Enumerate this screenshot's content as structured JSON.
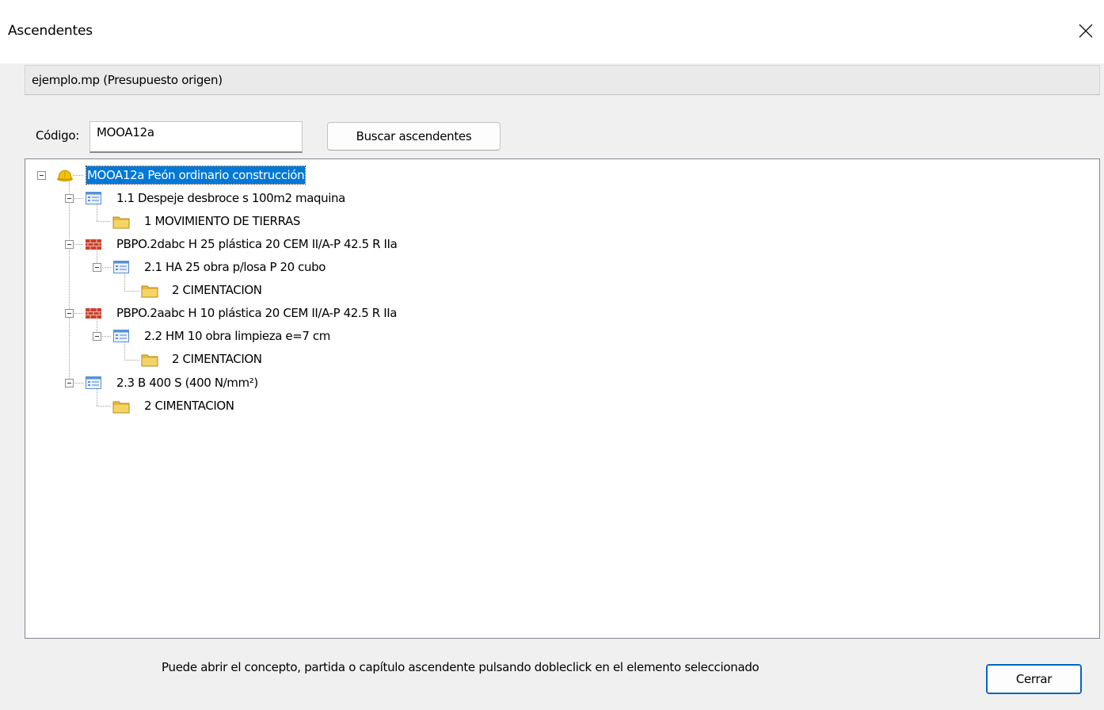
{
  "window": {
    "title": "Ascendentes"
  },
  "source": {
    "label": "ejemplo.mp (Presupuesto origen)"
  },
  "search": {
    "code_label": "Código:",
    "code_value": "MOOA12a",
    "search_button": "Buscar ascendentes"
  },
  "tree": {
    "nodes": [
      {
        "label": "MOOA12a Peón ordinario construcción",
        "icon": "hard-hat-icon",
        "selected": true
      },
      {
        "label": "1.1 Despeje desbroce s 100m2 maquina",
        "icon": "item-list-icon"
      },
      {
        "label": "1 MOVIMIENTO DE TIERRAS",
        "icon": "folder-icon"
      },
      {
        "label": "PBPO.2dabc H 25 plástica 20 CEM II/A-P 42.5 R IIa",
        "icon": "brick-icon"
      },
      {
        "label": "2.1 HA 25 obra p/losa P 20 cubo",
        "icon": "item-list-icon"
      },
      {
        "label": "2 CIMENTACION",
        "icon": "folder-icon"
      },
      {
        "label": "PBPO.2aabc H 10 plástica 20 CEM II/A-P 42.5 R IIa",
        "icon": "brick-icon"
      },
      {
        "label": "2.2 HM 10 obra limpieza e=7 cm",
        "icon": "item-list-icon"
      },
      {
        "label": "2 CIMENTACION",
        "icon": "folder-icon"
      },
      {
        "label": "2.3 B 400 S (400 N/mm²)",
        "icon": "item-list-icon"
      },
      {
        "label": "2 CIMENTACION",
        "icon": "folder-icon"
      }
    ]
  },
  "footer": {
    "note": "Puede abrir el concepto, partida o capítulo ascendente pulsando dobleclick en el elemento seleccionado",
    "close_button": "Cerrar"
  },
  "colors": {
    "selection": "#0078d7",
    "accent_border": "#0067c0",
    "folder": "#f2c94c",
    "brick": "#c9402c",
    "item_list": "#5b8fd6"
  }
}
